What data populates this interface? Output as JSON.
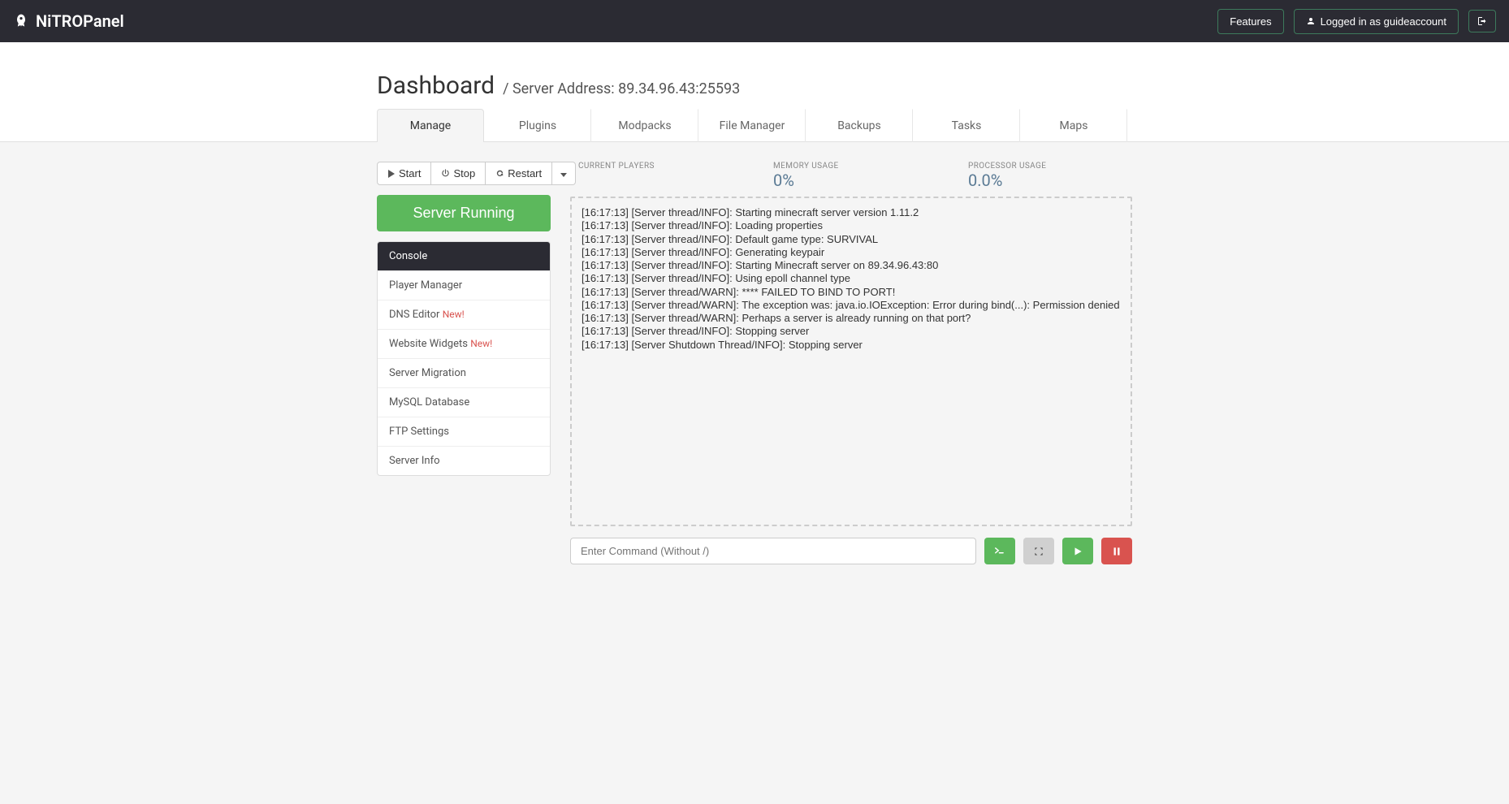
{
  "brand": {
    "name": "NiTROPanel"
  },
  "header": {
    "features_label": "Features",
    "logged_in_prefix": "Logged in as ",
    "logged_in_user": "guideaccount"
  },
  "page": {
    "title": "Dashboard",
    "subtitle": "/ Server Address: 89.34.96.43:25593"
  },
  "tabs": [
    {
      "label": "Manage",
      "active": true
    },
    {
      "label": "Plugins"
    },
    {
      "label": "Modpacks"
    },
    {
      "label": "File Manager"
    },
    {
      "label": "Backups"
    },
    {
      "label": "Tasks"
    },
    {
      "label": "Maps"
    }
  ],
  "controls": {
    "start": "Start",
    "stop": "Stop",
    "restart": "Restart"
  },
  "status": {
    "label": "Server Running"
  },
  "sidebar": {
    "items": [
      {
        "label": "Console",
        "active": true
      },
      {
        "label": "Player Manager"
      },
      {
        "label": "DNS Editor",
        "tag": "New!"
      },
      {
        "label": "Website Widgets",
        "tag": "New!"
      },
      {
        "label": "Server Migration"
      },
      {
        "label": "MySQL Database"
      },
      {
        "label": "FTP Settings"
      },
      {
        "label": "Server Info"
      }
    ]
  },
  "stats": {
    "players_label": "CURRENT PLAYERS",
    "memory_label": "MEMORY USAGE",
    "memory_value": "0%",
    "cpu_label": "PROCESSOR USAGE",
    "cpu_value": "0.0%"
  },
  "console_lines": [
    "[16:17:13] [Server thread/INFO]: Starting minecraft server version 1.11.2",
    "[16:17:13] [Server thread/INFO]: Loading properties",
    "[16:17:13] [Server thread/INFO]: Default game type: SURVIVAL",
    "[16:17:13] [Server thread/INFO]: Generating keypair",
    "[16:17:13] [Server thread/INFO]: Starting Minecraft server on 89.34.96.43:80",
    "[16:17:13] [Server thread/INFO]: Using epoll channel type",
    "[16:17:13] [Server thread/WARN]: **** FAILED TO BIND TO PORT!",
    "[16:17:13] [Server thread/WARN]: The exception was: java.io.IOException: Error during bind(...): Permission denied",
    "[16:17:13] [Server thread/WARN]: Perhaps a server is already running on that port?",
    "[16:17:13] [Server thread/INFO]: Stopping server",
    "[16:17:13] [Server Shutdown Thread/INFO]: Stopping server"
  ],
  "command": {
    "placeholder": "Enter Command (Without /)"
  }
}
